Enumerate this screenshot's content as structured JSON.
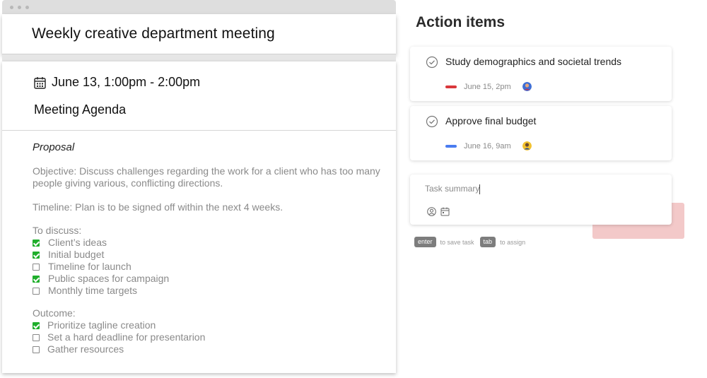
{
  "meeting": {
    "title": "Weekly creative department meeting",
    "date": "June 13, 1:00pm - 2:00pm",
    "agenda_title": "Meeting Agenda",
    "section_heading": "Proposal",
    "objective": "Objective: Discuss challenges regarding the work for a client who has too many people giving various, conflicting directions.",
    "timeline": "Timeline: Plan is to be signed off within the next 4 weeks.",
    "discuss_heading": "To discuss:",
    "discuss_items": [
      {
        "label": "Client’s ideas",
        "checked": true
      },
      {
        "label": "Initial budget",
        "checked": true
      },
      {
        "label": "Timeline for launch",
        "checked": false
      },
      {
        "label": "Public spaces for campaign",
        "checked": true
      },
      {
        "label": "Monthly time targets",
        "checked": false
      }
    ],
    "outcome_heading": "Outcome:",
    "outcome_items": [
      {
        "label": "Prioritize tagline creation",
        "checked": true
      },
      {
        "label": "Set a hard deadline for presentarion",
        "checked": false
      },
      {
        "label": "Gather resources",
        "checked": false
      }
    ]
  },
  "action_items": {
    "title": "Action items",
    "tasks": [
      {
        "label": "Study demographics and societal trends",
        "due": "June 15, 2pm",
        "priority_color": "#d9373b"
      },
      {
        "label": "Approve final budget",
        "due": "June 16, 9am",
        "priority_color": "#4a7cf0"
      }
    ],
    "summary": {
      "placeholder": "Task summary"
    },
    "hints": [
      {
        "key": "enter",
        "text": "to save task"
      },
      {
        "key": "tab",
        "text": "to assign"
      }
    ]
  },
  "colors": {
    "checkbox_checked": "#1fae2b",
    "pink_block": "#f3c9c9"
  }
}
